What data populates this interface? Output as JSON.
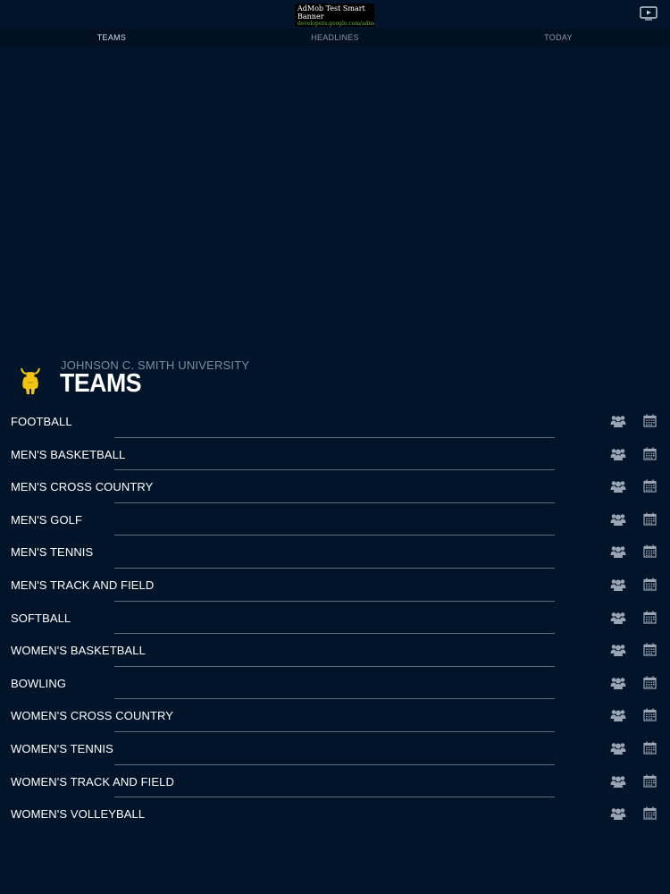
{
  "ad": {
    "title": "AdMob Test Smart Banner",
    "url": "developers.google.com/admob"
  },
  "tabs": [
    {
      "label": "TEAMS",
      "active": true
    },
    {
      "label": "HEADLINES",
      "active": false
    },
    {
      "label": "TODAY",
      "active": false
    }
  ],
  "header": {
    "school_name": "JOHNSON C. SMITH UNIVERSITY",
    "title": "TEAMS"
  },
  "teams": [
    {
      "name": "FOOTBALL"
    },
    {
      "name": "MEN'S BASKETBALL"
    },
    {
      "name": "MEN'S CROSS COUNTRY"
    },
    {
      "name": "MEN'S GOLF"
    },
    {
      "name": "MEN'S TENNIS"
    },
    {
      "name": "MEN'S TRACK AND FIELD"
    },
    {
      "name": "SOFTBALL"
    },
    {
      "name": "WOMEN'S BASKETBALL"
    },
    {
      "name": "BOWLING"
    },
    {
      "name": "WOMEN'S CROSS COUNTRY"
    },
    {
      "name": "WOMEN'S TENNIS"
    },
    {
      "name": "WOMEN'S TRACK AND FIELD"
    },
    {
      "name": "WOMEN'S VOLLEYBALL"
    }
  ],
  "icons": {
    "video": "tv-play-icon",
    "roster": "people-icon",
    "schedule": "calendar-icon",
    "logo": "golden-bull-logo"
  },
  "colors": {
    "background": "#021429",
    "tabbar": "#011022",
    "logo_gold": "#f2c40f",
    "icon_gray": "#9aa5b4",
    "divider": "#5d6b7e"
  }
}
